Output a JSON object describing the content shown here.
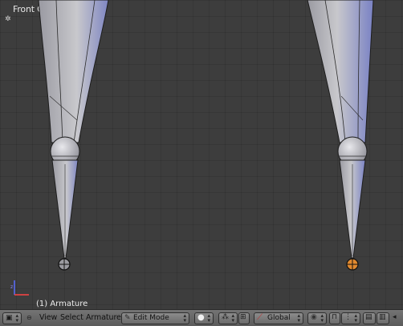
{
  "viewport": {
    "title": "Front Ortho",
    "object_label": "(1) Armature"
  },
  "header": {
    "menu": {
      "view": "View",
      "select": "Select",
      "armature": "Armature"
    },
    "mode_dropdown": {
      "value": "Edit Mode",
      "icon": "edit-mode-icon"
    },
    "orientation_dropdown": {
      "value": "Global"
    }
  },
  "colors": {
    "viewport_bg": "#3d3d3d",
    "bone_fill": "#b8b8bd",
    "bone_highlight": "#8088c8",
    "selected_joint": "#e0892f",
    "header_bg": "#6e6e6e"
  }
}
